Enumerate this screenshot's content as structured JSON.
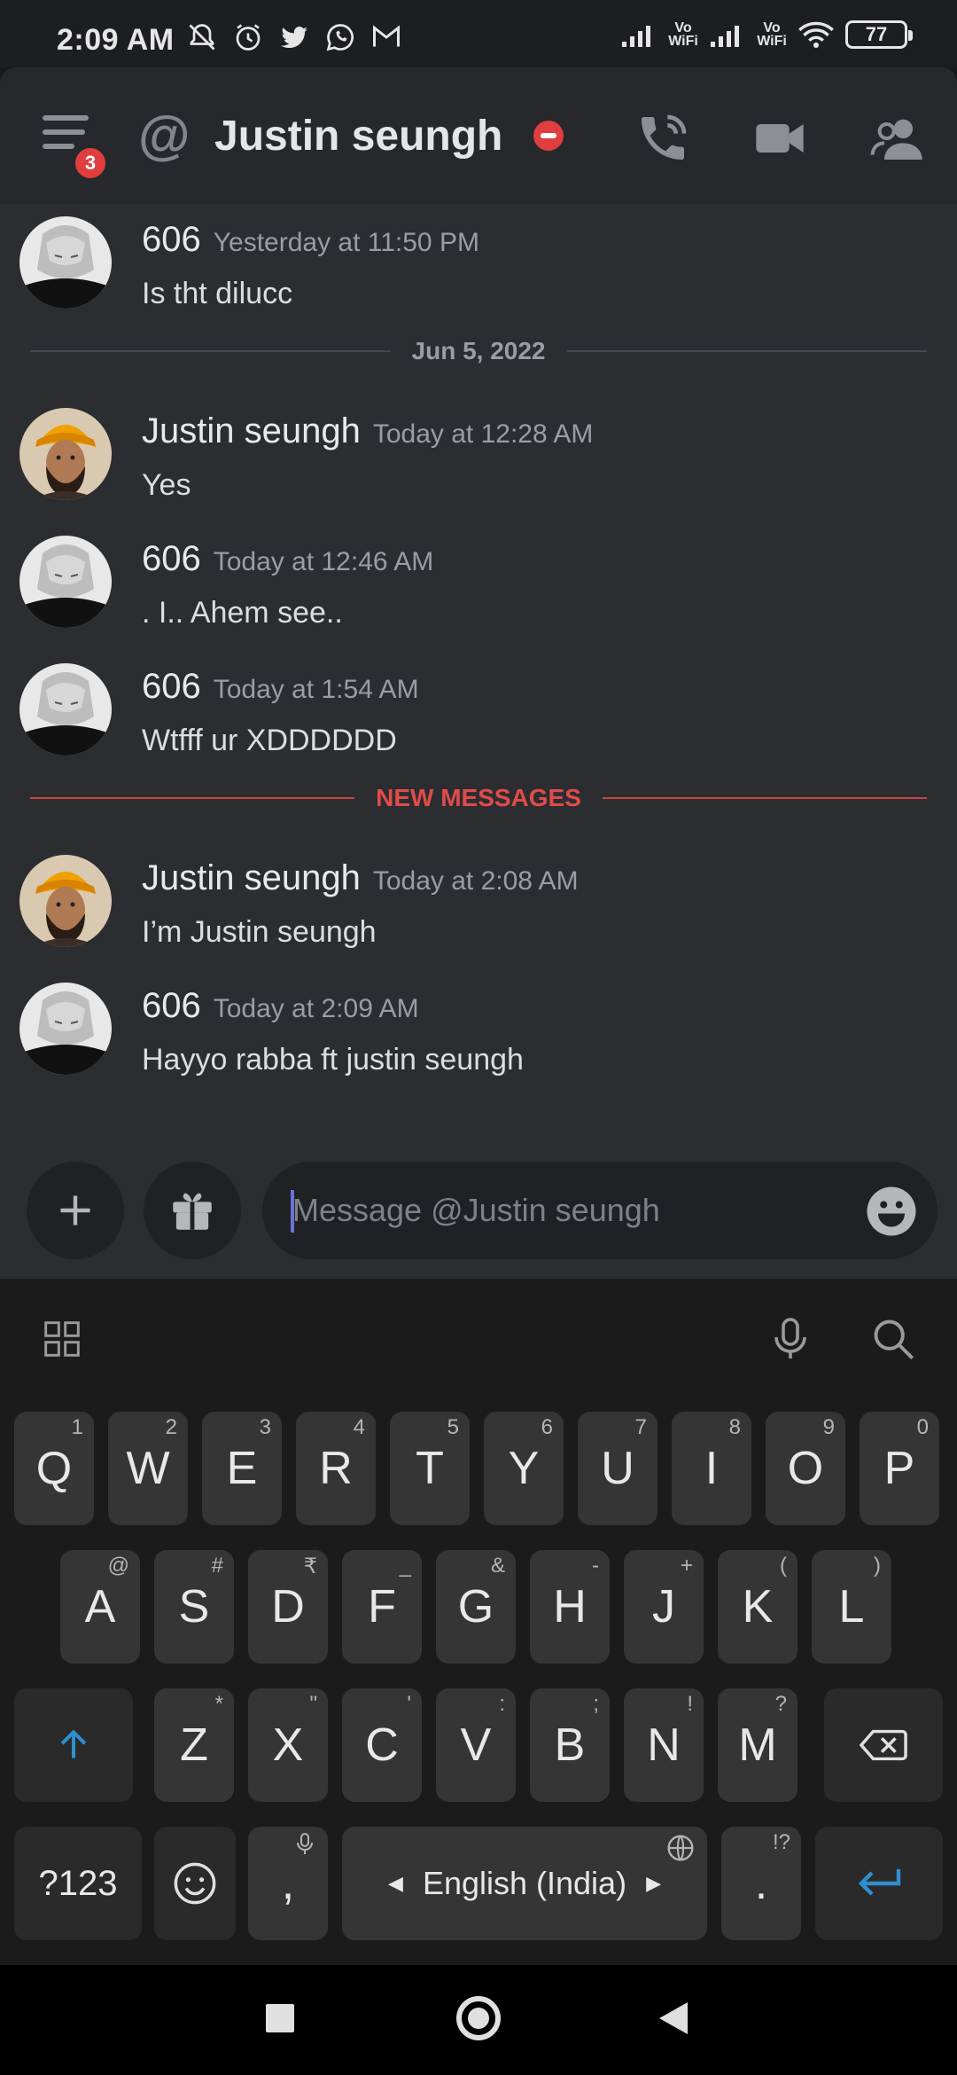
{
  "status_bar": {
    "time": "2:09 AM",
    "vowifi_1": "Vo\nWiFi",
    "vowifi_2": "Vo\nWiFi",
    "battery": "77"
  },
  "header": {
    "notification_count": "3",
    "title": "Justin seungh"
  },
  "messages": [
    {
      "author": "606",
      "timestamp": "Yesterday at 11:50 PM",
      "text": "Is tht dilucc",
      "avatar": "anime"
    },
    {
      "author": "Justin seungh",
      "timestamp": "Today at 12:28 AM",
      "text": "Yes",
      "avatar": "turban"
    },
    {
      "author": "606",
      "timestamp": "Today at 12:46 AM",
      "text": ". I.. Ahem see..",
      "avatar": "anime"
    },
    {
      "author": "606",
      "timestamp": "Today at 1:54 AM",
      "text": "Wtfff ur XDDDDDD",
      "avatar": "anime"
    },
    {
      "author": "Justin seungh",
      "timestamp": "Today at 2:08 AM",
      "text": "I’m Justin seungh",
      "avatar": "turban"
    },
    {
      "author": "606",
      "timestamp": "Today at 2:09 AM",
      "text": "Hayyo rabba ft justin seungh",
      "avatar": "anime"
    }
  ],
  "dividers": {
    "date": "Jun 5, 2022",
    "new_messages": "NEW MESSAGES"
  },
  "composer": {
    "placeholder": "Message @Justin seungh"
  },
  "keyboard": {
    "row1": [
      {
        "key": "Q",
        "hint": "1"
      },
      {
        "key": "W",
        "hint": "2"
      },
      {
        "key": "E",
        "hint": "3"
      },
      {
        "key": "R",
        "hint": "4"
      },
      {
        "key": "T",
        "hint": "5"
      },
      {
        "key": "Y",
        "hint": "6"
      },
      {
        "key": "U",
        "hint": "7"
      },
      {
        "key": "I",
        "hint": "8"
      },
      {
        "key": "O",
        "hint": "9"
      },
      {
        "key": "P",
        "hint": "0"
      }
    ],
    "row2": [
      {
        "key": "A",
        "hint": "@"
      },
      {
        "key": "S",
        "hint": "#"
      },
      {
        "key": "D",
        "hint": "₹"
      },
      {
        "key": "F",
        "hint": "_"
      },
      {
        "key": "G",
        "hint": "&"
      },
      {
        "key": "H",
        "hint": "-"
      },
      {
        "key": "J",
        "hint": "+"
      },
      {
        "key": "K",
        "hint": "("
      },
      {
        "key": "L",
        "hint": ")"
      }
    ],
    "row3": [
      {
        "key": "Z",
        "hint": "*"
      },
      {
        "key": "X",
        "hint": "\""
      },
      {
        "key": "C",
        "hint": "'"
      },
      {
        "key": "V",
        "hint": ":"
      },
      {
        "key": "B",
        "hint": ";"
      },
      {
        "key": "N",
        "hint": "!"
      },
      {
        "key": "M",
        "hint": "?"
      }
    ],
    "symbols_key": "?123",
    "comma": ",",
    "space_label": "English (India)",
    "period": ".",
    "period_hint": "!?"
  }
}
